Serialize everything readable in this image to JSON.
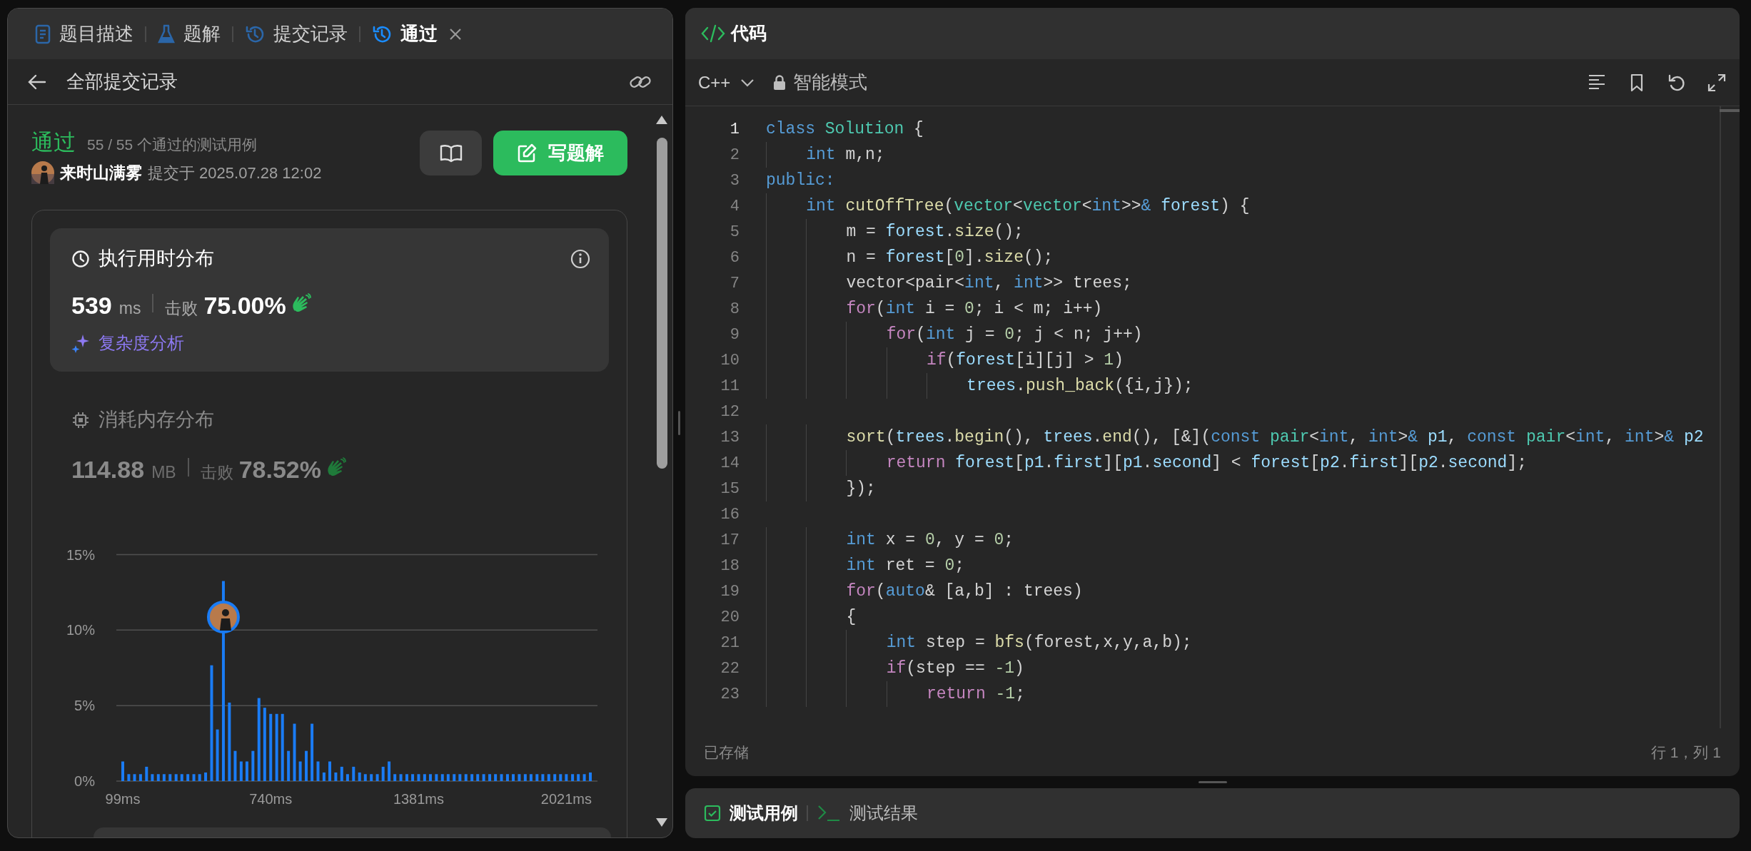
{
  "left_panel": {
    "tabs": [
      {
        "label": "题目描述",
        "selected": false,
        "closable": false
      },
      {
        "label": "题解",
        "selected": false,
        "closable": false
      },
      {
        "label": "提交记录",
        "selected": false,
        "closable": false
      },
      {
        "label": "通过",
        "selected": true,
        "closable": true
      }
    ],
    "back_title": "全部提交记录",
    "submission": {
      "status": "通过",
      "tests": "55 / 55 个通过的测试用例",
      "author": "来时山满雾",
      "submitted": "提交于 2025.07.28 12:02",
      "solution_button": "写题解"
    },
    "distributions": [
      {
        "kind": "runtime",
        "title": "执行用时分布",
        "value": "539",
        "unit": "ms",
        "beat_label": "击败",
        "beat": "75.00%",
        "selected": true,
        "analysis": "复杂度分析"
      },
      {
        "kind": "memory",
        "title": "消耗内存分布",
        "value": "114.88",
        "unit": "MB",
        "beat_label": "击败",
        "beat": "78.52%",
        "selected": false
      }
    ],
    "chart_data": {
      "type": "bar",
      "x": [
        99,
        125,
        150,
        176,
        202,
        227,
        253,
        278,
        304,
        330,
        355,
        381,
        407,
        432,
        458,
        484,
        509,
        535,
        561,
        586,
        612,
        637,
        663,
        689,
        714,
        740,
        766,
        791,
        817,
        843,
        868,
        894,
        919,
        945,
        971,
        996,
        1022,
        1048,
        1073,
        1099,
        1125,
        1150,
        1176,
        1202,
        1227,
        1253,
        1278,
        1304,
        1330,
        1355,
        1381,
        1407,
        1432,
        1458,
        1484,
        1509,
        1535,
        1560,
        1586,
        1612,
        1637,
        1663,
        1689,
        1714,
        1740,
        1766,
        1791,
        1817,
        1843,
        1868,
        1894,
        1919,
        1945,
        1971,
        1996,
        2021,
        2048,
        2073,
        2099,
        2125
      ],
      "values": [
        1.3,
        0.46,
        0.46,
        0.46,
        0.95,
        0.46,
        0.46,
        0.46,
        0.46,
        0.46,
        0.46,
        0.46,
        0.46,
        0.46,
        0.57,
        7.67,
        3.42,
        13.25,
        5.2,
        2.0,
        1.3,
        1.3,
        2.0,
        5.5,
        4.86,
        4.45,
        4.45,
        4.45,
        2.0,
        3.8,
        1.3,
        2.0,
        3.8,
        1.3,
        0.57,
        1.3,
        0.57,
        0.95,
        0.46,
        0.95,
        0.57,
        0.46,
        0.46,
        0.46,
        0.95,
        1.3,
        0.46,
        0.46,
        0.46,
        0.46,
        0.46,
        0.46,
        0.46,
        0.46,
        0.46,
        0.46,
        0.46,
        0.46,
        0.46,
        0.46,
        0.46,
        0.46,
        0.46,
        0.46,
        0.46,
        0.46,
        0.46,
        0.46,
        0.46,
        0.46,
        0.46,
        0.46,
        0.46,
        0.46,
        0.46,
        0.46,
        0.46,
        0.46,
        0.46,
        0.57
      ],
      "xlim": [
        99,
        2125
      ],
      "ylim": [
        0,
        15
      ],
      "xticks": [
        {
          "value": 99,
          "label": "99ms"
        },
        {
          "value": 740,
          "label": "740ms"
        },
        {
          "value": 1381,
          "label": "1381ms"
        },
        {
          "value": 2021,
          "label": "2021ms"
        }
      ],
      "yticks": [
        {
          "value": 0,
          "label": "0%"
        },
        {
          "value": 5,
          "label": "5%"
        },
        {
          "value": 10,
          "label": "10%"
        },
        {
          "value": 15,
          "label": "15%"
        }
      ]
    }
  },
  "editor": {
    "title": "代码",
    "language": "C++",
    "mode": "智能模式",
    "lines": [
      {
        "number": "1",
        "active": true,
        "tokens": [
          {
            "kind": "keyword",
            "text": "class"
          },
          {
            "kind": "type",
            "text": " Solution"
          },
          {
            "kind": "plain",
            "text": " {"
          }
        ]
      },
      {
        "number": "2",
        "active": false,
        "tokens": [
          {
            "kind": "keyword",
            "text": "    int"
          },
          {
            "kind": "plain",
            "text": " m,n;"
          }
        ]
      },
      {
        "number": "3",
        "active": false,
        "tokens": [
          {
            "kind": "keyword",
            "text": "public:"
          }
        ]
      },
      {
        "number": "4",
        "active": false,
        "tokens": [
          {
            "kind": "keyword",
            "text": "    int"
          },
          {
            "kind": "function",
            "text": " cutOffTree"
          },
          {
            "kind": "plain",
            "text": "("
          },
          {
            "kind": "type",
            "text": "vector"
          },
          {
            "kind": "plain",
            "text": "<"
          },
          {
            "kind": "type",
            "text": "vector"
          },
          {
            "kind": "plain",
            "text": "<"
          },
          {
            "kind": "keyword",
            "text": "int"
          },
          {
            "kind": "plain",
            "text": ">>"
          },
          {
            "kind": "keyword",
            "text": "&"
          },
          {
            "kind": "variable",
            "text": " forest"
          },
          {
            "kind": "plain",
            "text": ") {"
          }
        ]
      },
      {
        "number": "5",
        "active": false,
        "tokens": [
          {
            "kind": "plain",
            "text": "        m = "
          },
          {
            "kind": "variable",
            "text": "forest"
          },
          {
            "kind": "plain",
            "text": "."
          },
          {
            "kind": "function",
            "text": "size"
          },
          {
            "kind": "plain",
            "text": "();"
          }
        ]
      },
      {
        "number": "6",
        "active": false,
        "tokens": [
          {
            "kind": "plain",
            "text": "        n = "
          },
          {
            "kind": "variable",
            "text": "forest"
          },
          {
            "kind": "plain",
            "text": "["
          },
          {
            "kind": "number",
            "text": "0"
          },
          {
            "kind": "plain",
            "text": "]."
          },
          {
            "kind": "function",
            "text": "size"
          },
          {
            "kind": "plain",
            "text": "();"
          }
        ]
      },
      {
        "number": "7",
        "active": false,
        "tokens": [
          {
            "kind": "plain",
            "text": "        vector<pair<"
          },
          {
            "kind": "keyword",
            "text": "int"
          },
          {
            "kind": "plain",
            "text": ", "
          },
          {
            "kind": "keyword",
            "text": "int"
          },
          {
            "kind": "plain",
            "text": ">> trees;"
          }
        ]
      },
      {
        "number": "8",
        "active": false,
        "tokens": [
          {
            "kind": "control",
            "text": "        for"
          },
          {
            "kind": "plain",
            "text": "("
          },
          {
            "kind": "keyword",
            "text": "int"
          },
          {
            "kind": "plain",
            "text": " i = "
          },
          {
            "kind": "number",
            "text": "0"
          },
          {
            "kind": "plain",
            "text": "; i < m; i++)"
          }
        ]
      },
      {
        "number": "9",
        "active": false,
        "tokens": [
          {
            "kind": "control",
            "text": "            for"
          },
          {
            "kind": "plain",
            "text": "("
          },
          {
            "kind": "keyword",
            "text": "int"
          },
          {
            "kind": "plain",
            "text": " j = "
          },
          {
            "kind": "number",
            "text": "0"
          },
          {
            "kind": "plain",
            "text": "; j < n; j++)"
          }
        ]
      },
      {
        "number": "10",
        "active": false,
        "tokens": [
          {
            "kind": "control",
            "text": "                if"
          },
          {
            "kind": "plain",
            "text": "("
          },
          {
            "kind": "variable",
            "text": "forest"
          },
          {
            "kind": "plain",
            "text": "[i][j] > "
          },
          {
            "kind": "number",
            "text": "1"
          },
          {
            "kind": "plain",
            "text": ")"
          }
        ]
      },
      {
        "number": "11",
        "active": false,
        "tokens": [
          {
            "kind": "variable",
            "text": "                    trees"
          },
          {
            "kind": "plain",
            "text": "."
          },
          {
            "kind": "function",
            "text": "push_back"
          },
          {
            "kind": "plain",
            "text": "({i,j});"
          }
        ]
      },
      {
        "number": "12",
        "active": false
      },
      {
        "number": "13",
        "active": false,
        "tokens": [
          {
            "kind": "function",
            "text": "        sort"
          },
          {
            "kind": "plain",
            "text": "("
          },
          {
            "kind": "variable",
            "text": "trees"
          },
          {
            "kind": "plain",
            "text": "."
          },
          {
            "kind": "function",
            "text": "begin"
          },
          {
            "kind": "plain",
            "text": "(), "
          },
          {
            "kind": "variable",
            "text": "trees"
          },
          {
            "kind": "plain",
            "text": "."
          },
          {
            "kind": "function",
            "text": "end"
          },
          {
            "kind": "plain",
            "text": "(), [&]("
          },
          {
            "kind": "keyword",
            "text": "const"
          },
          {
            "kind": "type",
            "text": " pair"
          },
          {
            "kind": "plain",
            "text": "<"
          },
          {
            "kind": "keyword",
            "text": "int"
          },
          {
            "kind": "plain",
            "text": ", "
          },
          {
            "kind": "keyword",
            "text": "int"
          },
          {
            "kind": "plain",
            "text": ">"
          },
          {
            "kind": "keyword",
            "text": "&"
          },
          {
            "kind": "variable",
            "text": " p1"
          },
          {
            "kind": "plain",
            "text": ", "
          },
          {
            "kind": "keyword",
            "text": "const"
          },
          {
            "kind": "type",
            "text": " pair"
          },
          {
            "kind": "plain",
            "text": "<"
          },
          {
            "kind": "keyword",
            "text": "int"
          },
          {
            "kind": "plain",
            "text": ", "
          },
          {
            "kind": "keyword",
            "text": "int"
          },
          {
            "kind": "plain",
            "text": ">"
          },
          {
            "kind": "keyword",
            "text": "&"
          },
          {
            "kind": "variable",
            "text": " p2"
          }
        ]
      },
      {
        "number": "14",
        "active": false,
        "tokens": [
          {
            "kind": "control",
            "text": "            return"
          },
          {
            "kind": "variable",
            "text": " forest"
          },
          {
            "kind": "plain",
            "text": "["
          },
          {
            "kind": "variable",
            "text": "p1"
          },
          {
            "kind": "plain",
            "text": "."
          },
          {
            "kind": "variable",
            "text": "first"
          },
          {
            "kind": "plain",
            "text": "]["
          },
          {
            "kind": "variable",
            "text": "p1"
          },
          {
            "kind": "plain",
            "text": "."
          },
          {
            "kind": "variable",
            "text": "second"
          },
          {
            "kind": "plain",
            "text": "] < "
          },
          {
            "kind": "variable",
            "text": "forest"
          },
          {
            "kind": "plain",
            "text": "["
          },
          {
            "kind": "variable",
            "text": "p2"
          },
          {
            "kind": "plain",
            "text": "."
          },
          {
            "kind": "variable",
            "text": "first"
          },
          {
            "kind": "plain",
            "text": "]["
          },
          {
            "kind": "variable",
            "text": "p2"
          },
          {
            "kind": "plain",
            "text": "."
          },
          {
            "kind": "variable",
            "text": "second"
          },
          {
            "kind": "plain",
            "text": "];"
          }
        ]
      },
      {
        "number": "15",
        "active": false,
        "tokens": [
          {
            "kind": "plain",
            "text": "        });"
          }
        ]
      },
      {
        "number": "16",
        "active": false
      },
      {
        "number": "17",
        "active": false,
        "tokens": [
          {
            "kind": "keyword",
            "text": "        int"
          },
          {
            "kind": "plain",
            "text": " x = "
          },
          {
            "kind": "number",
            "text": "0"
          },
          {
            "kind": "plain",
            "text": ", y = "
          },
          {
            "kind": "number",
            "text": "0"
          },
          {
            "kind": "plain",
            "text": ";"
          }
        ]
      },
      {
        "number": "18",
        "active": false,
        "tokens": [
          {
            "kind": "keyword",
            "text": "        int"
          },
          {
            "kind": "plain",
            "text": " ret = "
          },
          {
            "kind": "number",
            "text": "0"
          },
          {
            "kind": "plain",
            "text": ";"
          }
        ]
      },
      {
        "number": "19",
        "active": false,
        "tokens": [
          {
            "kind": "control",
            "text": "        for"
          },
          {
            "kind": "plain",
            "text": "("
          },
          {
            "kind": "keyword",
            "text": "auto"
          },
          {
            "kind": "plain",
            "text": "& [a,b] : trees)"
          }
        ]
      },
      {
        "number": "20",
        "active": false,
        "tokens": [
          {
            "kind": "plain",
            "text": "        {"
          }
        ]
      },
      {
        "number": "21",
        "active": false,
        "tokens": [
          {
            "kind": "keyword",
            "text": "            int"
          },
          {
            "kind": "plain",
            "text": " step = "
          },
          {
            "kind": "function",
            "text": "bfs"
          },
          {
            "kind": "plain",
            "text": "(forest,x,y,a,b);"
          }
        ]
      },
      {
        "number": "22",
        "active": false,
        "tokens": [
          {
            "kind": "control",
            "text": "            if"
          },
          {
            "kind": "plain",
            "text": "(step == "
          },
          {
            "kind": "number",
            "text": "-1"
          },
          {
            "kind": "plain",
            "text": ")"
          }
        ]
      },
      {
        "number": "23",
        "active": false,
        "tokens": [
          {
            "kind": "control",
            "text": "                return"
          },
          {
            "kind": "number",
            "text": " -1"
          },
          {
            "kind": "plain",
            "text": ";"
          }
        ]
      }
    ],
    "status": "已存储",
    "cursor": "行 1，列 1"
  },
  "bottom_tabs": [
    {
      "label": "测试用例",
      "selected": true
    },
    {
      "label": "测试结果",
      "selected": false
    }
  ]
}
